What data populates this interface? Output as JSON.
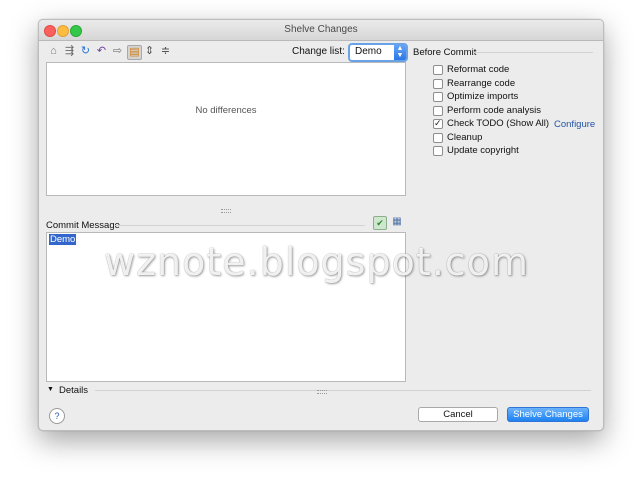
{
  "window": {
    "title": "Shelve Changes"
  },
  "toolbar": {
    "icons": [
      "home-icon",
      "merge-icon",
      "refresh-icon",
      "revert-icon",
      "forward-icon",
      "diff-view-icon",
      "expand-icon",
      "collapse-icon"
    ]
  },
  "changelist": {
    "label": "Change list:",
    "value": "Demo"
  },
  "diff": {
    "empty_text": "No differences"
  },
  "commit": {
    "label": "Commit Message",
    "text": "Demo"
  },
  "before_commit": {
    "title": "Before Commit",
    "options": [
      {
        "label": "Reformat code",
        "checked": false
      },
      {
        "label": "Rearrange code",
        "checked": false
      },
      {
        "label": "Optimize imports",
        "checked": false
      },
      {
        "label": "Perform code analysis",
        "checked": false
      },
      {
        "label": "Check TODO (Show All)",
        "checked": true
      },
      {
        "label": "Cleanup",
        "checked": false
      },
      {
        "label": "Update copyright",
        "checked": false
      }
    ],
    "configure_link": "Configure"
  },
  "details": {
    "label": "Details"
  },
  "buttons": {
    "help": "?",
    "cancel": "Cancel",
    "shelve": "Shelve Changes"
  },
  "watermark": "wznote.blogspot.com",
  "colors": {
    "primary_button": "#1e82f1",
    "link": "#2354a6",
    "selection": "#3366cc"
  }
}
